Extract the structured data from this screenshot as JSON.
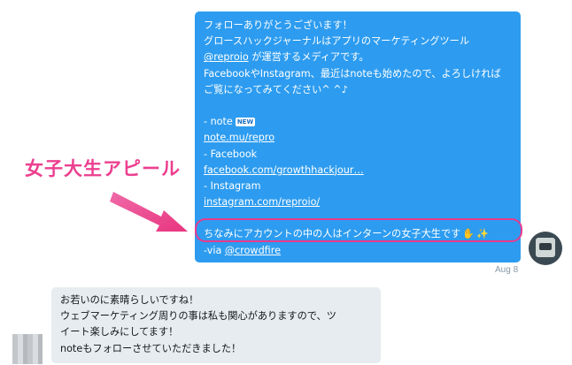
{
  "sent_message": {
    "lines": [
      "フォローありがとうございます！",
      "グロースハックジャーナルはアプリのマーケティングツール",
      "が運営するメディアです。",
      "FacebookやInstagram、最近はnoteも始めたので、よろしければ",
      "ご覧になってみてください^ ^♪",
      "",
      "- note",
      "",
      "- Facebook",
      "",
      "- Instagram",
      "",
      "",
      "ちなみにアカウントの中の人はインターンの女子大生です",
      "-via "
    ],
    "mention_reproio": "@reproio",
    "note_badge": "NEW",
    "link_note": "note.mu/repro",
    "link_facebook": "facebook.com/growthhackjour…",
    "link_instagram": "instagram.com/reproio/",
    "mention_crowdfire": "@crowdfire",
    "emojis": [
      "raised-hand",
      "sparkles"
    ]
  },
  "timestamp": "Aug 8",
  "received_message": {
    "lines": [
      "お若いのに素晴らしいですね！",
      "ウェブマーケティング周りの事は私も関心がありますので、ツ",
      "イート楽しみにしてます！",
      "noteもフォローさせていただきました！"
    ]
  },
  "annotation": {
    "label": "女子大生アピール",
    "color": "#ec3f8f"
  },
  "colors": {
    "sent_bubble": "#2d9cf0",
    "received_bubble": "#e6ecf0",
    "timestamp": "#8899a6"
  }
}
